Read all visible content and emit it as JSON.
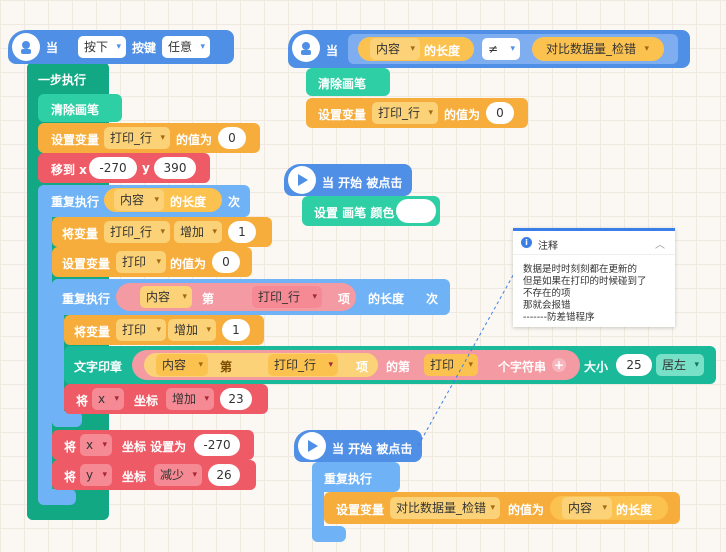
{
  "s1": {
    "when": "当",
    "press": "按下",
    "key": "按键",
    "any": "任意",
    "step": "一步执行",
    "clear": "清除画笔",
    "setvar": "设置变量",
    "var_print_row": "打印_行",
    "value_is": "的值为",
    "zero": "0",
    "moveto": "移到 x",
    "x_val": "-270",
    "y_label": "y",
    "y_val": "390",
    "repeat": "重复执行",
    "content": "内容",
    "length_of": "的长度",
    "times": "次",
    "change_var": "将变量",
    "increase": "增加",
    "one": "1",
    "set_var2": "设置变量",
    "var_print": "打印",
    "value_is2": "的值为",
    "zero2": "0",
    "repeat2": "重复执行",
    "content2": "内容",
    "index_of": "第",
    "print_row2": "打印_行",
    "item": "项",
    "length_of2": "的长度",
    "times2": "次",
    "change_var2": "将变量",
    "var_print2": "打印",
    "increase2": "增加",
    "one2": "1",
    "stamp": "文字印章",
    "content3": "内容",
    "index_of2": "第",
    "print_row3": "打印_行",
    "item2": "项",
    "nth": "的第",
    "print3": "打印",
    "char": "个字符串",
    "size": "大小",
    "size_val": "25",
    "align": "居左",
    "set_x_1": "将",
    "x": "x",
    "coord": "坐标",
    "increase3": "增加",
    "dx": "23",
    "set_x_2": "将",
    "x2": "x",
    "coord_set": "坐标 设置为",
    "xval2": "-270",
    "set_y": "将",
    "y": "y",
    "coord2": "坐标",
    "decrease": "减少",
    "dy": "26"
  },
  "s2": {
    "when": "当",
    "content": "内容",
    "length_of": "的长度",
    "neq": "≠",
    "var_cmp": "对比数据量_检错",
    "clear": "清除画笔",
    "setvar": "设置变量",
    "var_print_row": "打印_行",
    "value_is": "的值为",
    "zero": "0"
  },
  "s3": {
    "start": "当 开始 被点击",
    "pen_color": "设置 画笔 颜色"
  },
  "s4": {
    "start": "当 开始 被点击",
    "repeat": "重复执行",
    "setvar": "设置变量",
    "var_cmp": "对比数据量_检错",
    "value_is": "的值为",
    "content": "内容",
    "length_of": "的长度"
  },
  "note": {
    "title": "注释",
    "lines": [
      "数据是时时刻刻都在更新的",
      "但是如果在打印的时候碰到了",
      "不存在的项",
      "那就会报错",
      "-------防差错程序"
    ]
  },
  "colors": {
    "event": "#4f8fe6",
    "control": "#6fb2f5",
    "pen": "#2fcfa5",
    "data": "#f6ad3b",
    "motion": "#ee5b66"
  }
}
